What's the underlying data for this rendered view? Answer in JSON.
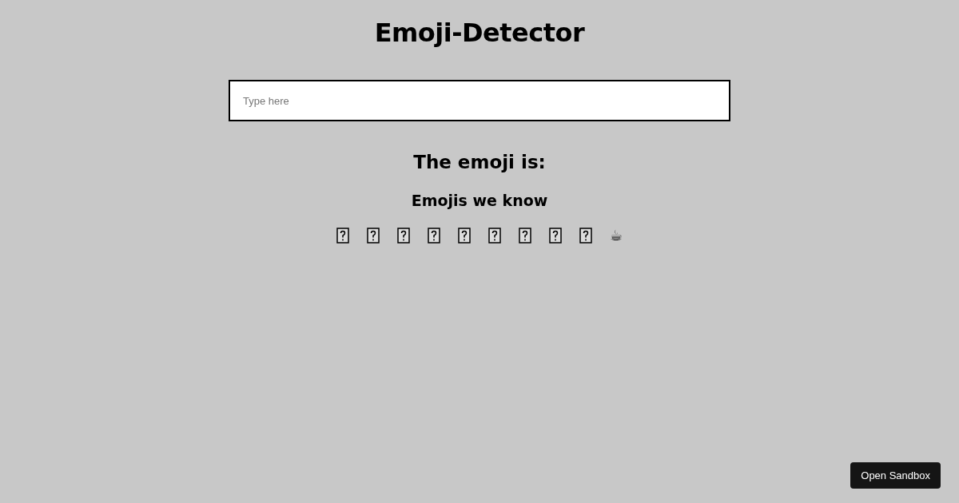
{
  "title": "Emoji-Detector",
  "search": {
    "placeholder": "Type here"
  },
  "result_heading": "The emoji is:",
  "known_heading": "Emojis we know",
  "emojis": [
    {
      "kind": "missing"
    },
    {
      "kind": "missing"
    },
    {
      "kind": "missing"
    },
    {
      "kind": "missing"
    },
    {
      "kind": "missing"
    },
    {
      "kind": "missing"
    },
    {
      "kind": "missing"
    },
    {
      "kind": "missing"
    },
    {
      "kind": "missing"
    },
    {
      "kind": "glyph",
      "text": "☕"
    }
  ],
  "sandbox_button": "Open Sandbox"
}
